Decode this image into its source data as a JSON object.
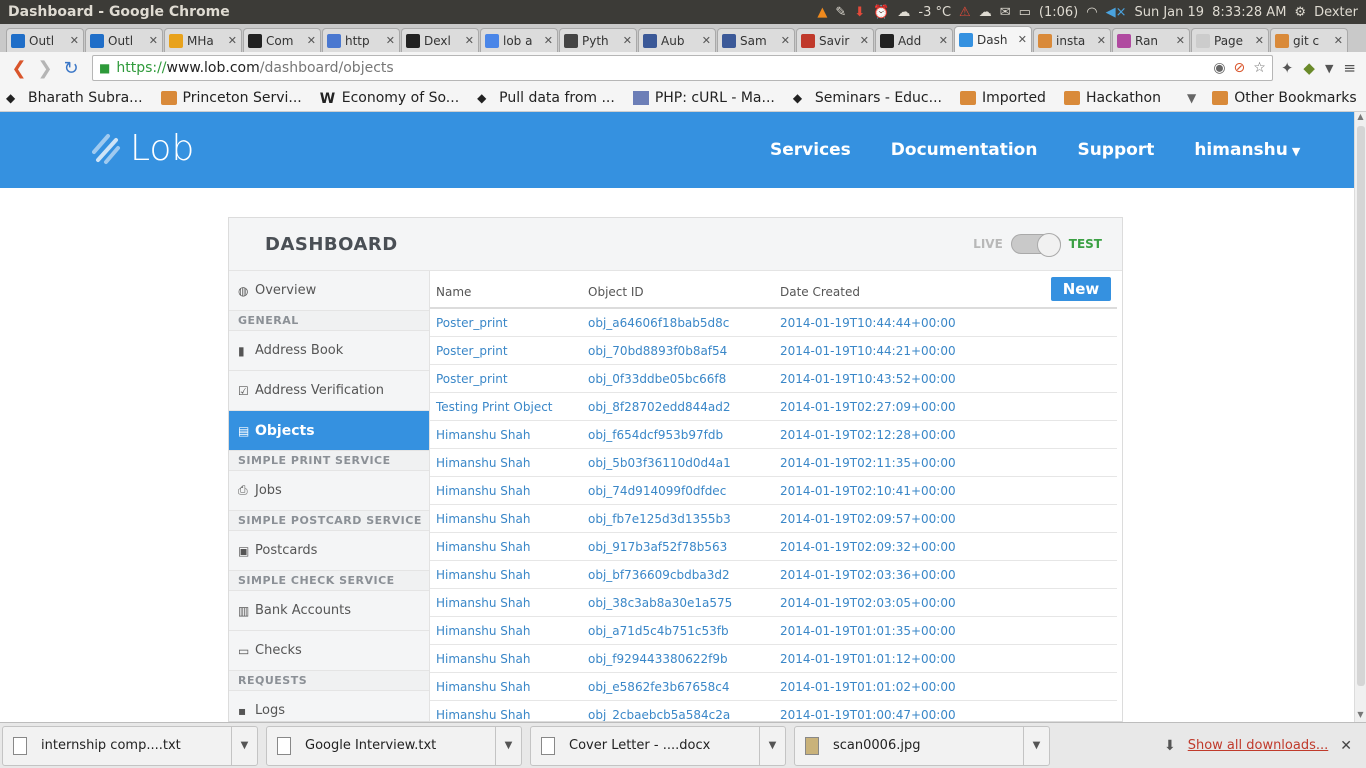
{
  "os": {
    "window_title": "Dashboard - Google Chrome",
    "temperature": "-3 °C",
    "battery": "(1:06)",
    "date": "Sun Jan 19",
    "time": "8:33:28 AM",
    "user": "Dexter"
  },
  "tabs": [
    {
      "label": "Outl",
      "fav_color": "#1f6ec8"
    },
    {
      "label": "Outl",
      "fav_color": "#1f6ec8"
    },
    {
      "label": "MHa",
      "fav_color": "#e8a21c"
    },
    {
      "label": "Com",
      "fav_color": "#222222"
    },
    {
      "label": "http",
      "fav_color": "#4a78d0"
    },
    {
      "label": "Dexl",
      "fav_color": "#222222"
    },
    {
      "label": "lob a",
      "fav_color": "#4a86e8"
    },
    {
      "label": "Pyth",
      "fav_color": "#444444"
    },
    {
      "label": "Aub",
      "fav_color": "#3b5998"
    },
    {
      "label": "Sam",
      "fav_color": "#3b5998"
    },
    {
      "label": "Savir",
      "fav_color": "#c0392b"
    },
    {
      "label": "Add",
      "fav_color": "#222222"
    },
    {
      "label": "Dash",
      "fav_color": "#3591e0",
      "active": true
    },
    {
      "label": "insta",
      "fav_color": "#d98a3a"
    },
    {
      "label": "Ran",
      "fav_color": "#b04aa0"
    },
    {
      "label": "Page",
      "fav_color": "#cccccc"
    },
    {
      "label": "git c",
      "fav_color": "#d98a3a"
    }
  ],
  "omnibox": {
    "scheme": "https://",
    "host": "www.lob.com",
    "path": "/dashboard/objects"
  },
  "bookmarks": [
    {
      "label": "Bharath Subra...",
      "type": "page"
    },
    {
      "label": "Princeton Servi...",
      "type": "folder"
    },
    {
      "label": "Economy of So...",
      "type": "wiki"
    },
    {
      "label": "Pull data from ...",
      "type": "page"
    },
    {
      "label": "PHP: cURL - Ma...",
      "type": "php"
    },
    {
      "label": "Seminars - Educ...",
      "type": "page"
    },
    {
      "label": "Imported",
      "type": "folder"
    },
    {
      "label": "Hackathon",
      "type": "folder"
    }
  ],
  "bookmarks_other": "Other Bookmarks",
  "lob": {
    "logo_text": "Lob",
    "nav": [
      "Services",
      "Documentation",
      "Support"
    ],
    "user_menu": "himanshu"
  },
  "dashboard": {
    "title": "DASHBOARD",
    "live_label": "LIVE",
    "test_label": "TEST",
    "new_button": "New",
    "columns": [
      "Name",
      "Object ID",
      "Date Created"
    ]
  },
  "sidebar": [
    {
      "type": "item",
      "label": "Overview",
      "icon": "dashboard-icon",
      "glyph": "◍"
    },
    {
      "type": "header",
      "label": "GENERAL"
    },
    {
      "type": "item",
      "label": "Address Book",
      "icon": "book-icon",
      "glyph": "▮"
    },
    {
      "type": "item",
      "label": "Address Verification",
      "icon": "check-square-icon",
      "glyph": "☑"
    },
    {
      "type": "item",
      "label": "Objects",
      "icon": "file-icon",
      "glyph": "▤",
      "active": true
    },
    {
      "type": "header",
      "label": "SIMPLE PRINT SERVICE"
    },
    {
      "type": "item",
      "label": "Jobs",
      "icon": "print-icon",
      "glyph": "⎙"
    },
    {
      "type": "header",
      "label": "SIMPLE POSTCARD SERVICE"
    },
    {
      "type": "item",
      "label": "Postcards",
      "icon": "image-icon",
      "glyph": "▣"
    },
    {
      "type": "header",
      "label": "SIMPLE CHECK SERVICE"
    },
    {
      "type": "item",
      "label": "Bank Accounts",
      "icon": "building-icon",
      "glyph": "▥"
    },
    {
      "type": "item",
      "label": "Checks",
      "icon": "money-icon",
      "glyph": "▭"
    },
    {
      "type": "header",
      "label": "REQUESTS"
    },
    {
      "type": "item",
      "label": "Logs",
      "icon": "logs-icon",
      "glyph": "▪"
    }
  ],
  "objects": [
    {
      "name": "Poster_print",
      "id": "obj_a64606f18bab5d8c",
      "date": "2014-01-19T10:44:44+00:00"
    },
    {
      "name": "Poster_print",
      "id": "obj_70bd8893f0b8af54",
      "date": "2014-01-19T10:44:21+00:00"
    },
    {
      "name": "Poster_print",
      "id": "obj_0f33ddbe05bc66f8",
      "date": "2014-01-19T10:43:52+00:00"
    },
    {
      "name": "Testing Print Object",
      "id": "obj_8f28702edd844ad2",
      "date": "2014-01-19T02:27:09+00:00"
    },
    {
      "name": "Himanshu Shah",
      "id": "obj_f654dcf953b97fdb",
      "date": "2014-01-19T02:12:28+00:00"
    },
    {
      "name": "Himanshu Shah",
      "id": "obj_5b03f36110d0d4a1",
      "date": "2014-01-19T02:11:35+00:00"
    },
    {
      "name": "Himanshu Shah",
      "id": "obj_74d914099f0dfdec",
      "date": "2014-01-19T02:10:41+00:00"
    },
    {
      "name": "Himanshu Shah",
      "id": "obj_fb7e125d3d1355b3",
      "date": "2014-01-19T02:09:57+00:00"
    },
    {
      "name": "Himanshu Shah",
      "id": "obj_917b3af52f78b563",
      "date": "2014-01-19T02:09:32+00:00"
    },
    {
      "name": "Himanshu Shah",
      "id": "obj_bf736609cbdba3d2",
      "date": "2014-01-19T02:03:36+00:00"
    },
    {
      "name": "Himanshu Shah",
      "id": "obj_38c3ab8a30e1a575",
      "date": "2014-01-19T02:03:05+00:00"
    },
    {
      "name": "Himanshu Shah",
      "id": "obj_a71d5c4b751c53fb",
      "date": "2014-01-19T01:01:35+00:00"
    },
    {
      "name": "Himanshu Shah",
      "id": "obj_f929443380622f9b",
      "date": "2014-01-19T01:01:12+00:00"
    },
    {
      "name": "Himanshu Shah",
      "id": "obj_e5862fe3b67658c4",
      "date": "2014-01-19T01:01:02+00:00"
    },
    {
      "name": "Himanshu Shah",
      "id": "obj_2cbaebcb5a584c2a",
      "date": "2014-01-19T01:00:47+00:00"
    }
  ],
  "downloads": [
    {
      "name": "internship comp....txt",
      "type": "txt"
    },
    {
      "name": "Google Interview.txt",
      "type": "txt"
    },
    {
      "name": "Cover Letter - ....docx",
      "type": "docx"
    },
    {
      "name": "scan0006.jpg",
      "type": "img"
    }
  ],
  "downloads_show_all": "Show all downloads..."
}
